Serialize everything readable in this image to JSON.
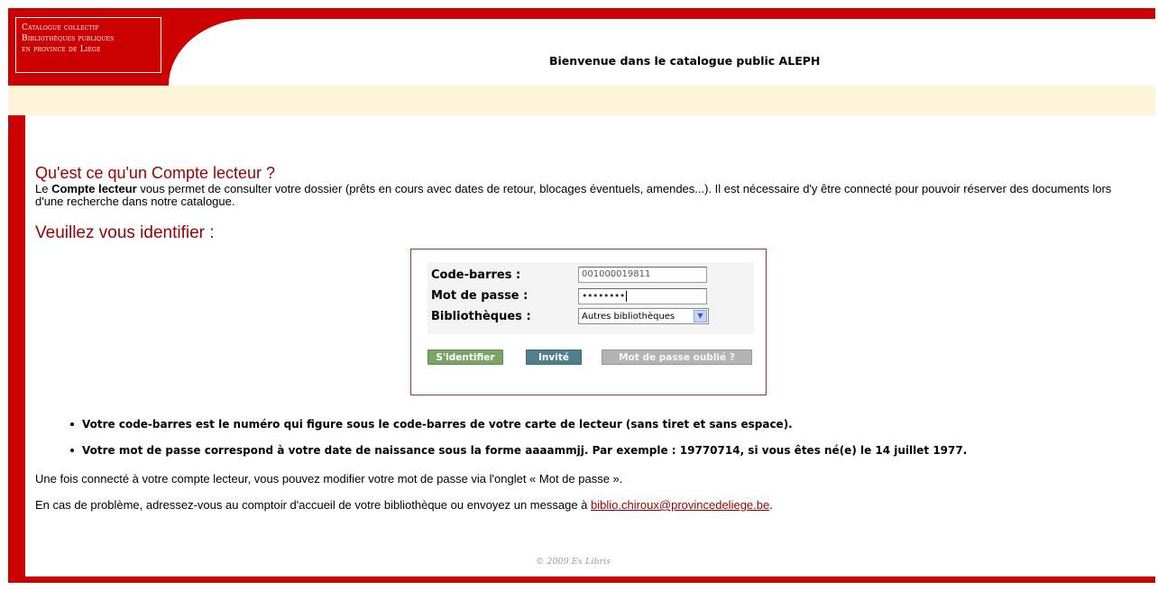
{
  "header": {
    "logo_text": "Catalogue collectif\nBibliothèques publiques\nen province de Liège",
    "welcome": "Bienvenue dans le catalogue public ALEPH"
  },
  "intro": {
    "title": "Qu'est ce qu'un Compte lecteur ?",
    "body_prefix": "Le ",
    "body_bold": "Compte lecteur",
    "body_suffix": " vous permet de consulter votre dossier (prêts en cours avec dates de retour, blocages éventuels, amendes...). Il est nécessaire d'y être connecté pour pouvoir réserver des documents lors d'une recherche dans notre catalogue."
  },
  "login": {
    "title": "Veuillez vous identifier :",
    "barcode_label": "Code-barres :",
    "barcode_value": "001000019811",
    "password_label": "Mot de passe :",
    "password_mask": "••••••••",
    "library_label": "Bibliothèques :",
    "library_selected": "Autres bibliothèques",
    "login_button": "S'identifier",
    "guest_button": "Invité",
    "forgot_button": "Mot de passe oublié ?"
  },
  "notes": {
    "bullet1": "Votre code-barres est le numéro qui figure sous le code-barres de votre carte de lecteur (sans tiret et sans espace).",
    "bullet2": "Votre mot de passe correspond à votre date de naissance sous la forme aaaammjj. Par exemple : 19770714, si vous êtes né(e) le 14 juillet 1977.",
    "para1": "Une fois connecté à votre compte lecteur, vous pouvez modifier votre mot de passe via l'onglet « Mot de passe ».",
    "para2_prefix": "En cas de problème, adressez-vous au comptoir d'accueil de votre bibliothèque ou envoyez un message à ",
    "email": "biblio.chiroux@provincedeliege.be",
    "para2_suffix": "."
  },
  "footer": {
    "copyright": "© 2009 Ex Libris"
  },
  "colors": {
    "frame_red": "#cc0000",
    "heading_red": "#990000",
    "band": "#fdf4d9",
    "login_button": "#7aa466",
    "guest_button": "#4f7f8a",
    "forgot_button": "#b3b3b3"
  }
}
